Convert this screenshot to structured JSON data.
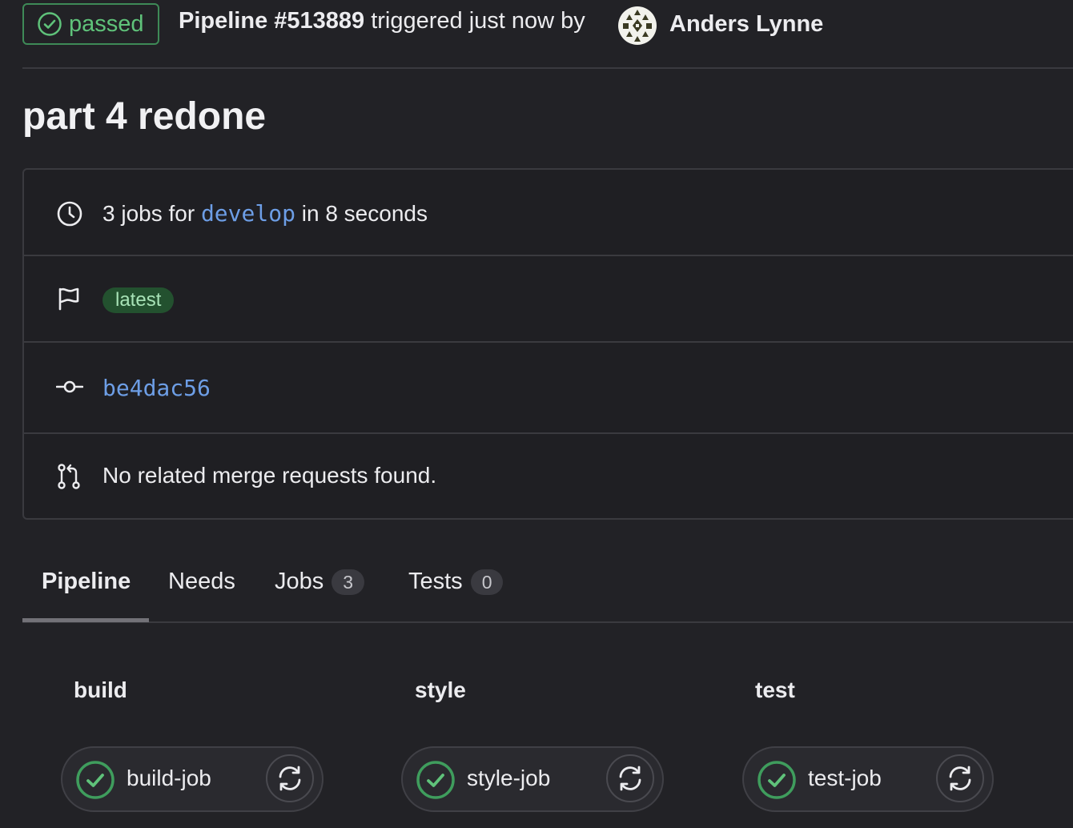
{
  "header": {
    "status": "passed",
    "pipeline_id": "Pipeline #513889",
    "trigger_text": "triggered just now by",
    "author": "Anders Lynne"
  },
  "title": "part 4 redone",
  "info": {
    "jobs_prefix": "3 jobs for",
    "branch": "develop",
    "duration_suffix": "in 8 seconds",
    "badge": "latest",
    "commit": "be4dac56",
    "merge_requests": "No related merge requests found."
  },
  "tabs": [
    {
      "label": "Pipeline",
      "count": null
    },
    {
      "label": "Needs",
      "count": null
    },
    {
      "label": "Jobs",
      "count": "3"
    },
    {
      "label": "Tests",
      "count": "0"
    }
  ],
  "stages": [
    {
      "name": "build",
      "job": "build-job"
    },
    {
      "name": "style",
      "job": "style-job"
    },
    {
      "name": "test",
      "job": "test-job"
    }
  ],
  "colors": {
    "success": "#5fc27a",
    "link": "#6d9ee6",
    "background": "#222226"
  }
}
